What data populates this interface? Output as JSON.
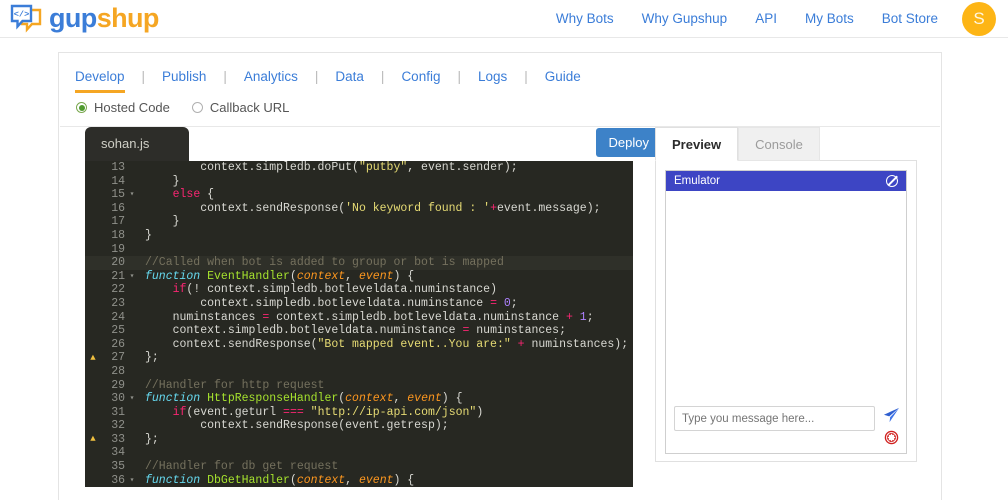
{
  "header": {
    "logo": {
      "icon": "code-chat-bubble-icon",
      "part1": "gup",
      "part2": "shup"
    },
    "nav": [
      {
        "label": "Why Bots"
      },
      {
        "label": "Why Gupshup"
      },
      {
        "label": "API"
      },
      {
        "label": "My Bots"
      },
      {
        "label": "Bot Store"
      }
    ],
    "avatar_initial": "S",
    "avatar_color": "#fdb515"
  },
  "tabs": [
    {
      "label": "Develop",
      "active": true
    },
    {
      "label": "Publish",
      "active": false
    },
    {
      "label": "Analytics",
      "active": false
    },
    {
      "label": "Data",
      "active": false
    },
    {
      "label": "Config",
      "active": false
    },
    {
      "label": "Logs",
      "active": false
    },
    {
      "label": "Guide",
      "active": false
    }
  ],
  "tab_separator": "|",
  "source_mode": {
    "options": [
      {
        "label": "Hosted Code",
        "selected": true
      },
      {
        "label": "Callback URL",
        "selected": false
      }
    ]
  },
  "editor": {
    "filename": "sohan.js",
    "deploy_label": "Deploy",
    "accent_color": "#f5a623",
    "background": "#272822",
    "lines": [
      {
        "n": 13,
        "warn": false,
        "fold": "",
        "hl": false,
        "tokens": [
          {
            "t": "        context.simpledb.doPut(",
            "c": "pl"
          },
          {
            "t": "\"putby\"",
            "c": "str"
          },
          {
            "t": ", event.sender);",
            "c": "pl"
          }
        ]
      },
      {
        "n": 14,
        "warn": false,
        "fold": "",
        "hl": false,
        "tokens": [
          {
            "t": "    }",
            "c": "pl"
          }
        ]
      },
      {
        "n": 15,
        "warn": false,
        "fold": "▾",
        "hl": false,
        "tokens": [
          {
            "t": "    ",
            "c": "pl"
          },
          {
            "t": "else",
            "c": "kw"
          },
          {
            "t": " {",
            "c": "pl"
          }
        ]
      },
      {
        "n": 16,
        "warn": false,
        "fold": "",
        "hl": false,
        "tokens": [
          {
            "t": "        context.sendResponse(",
            "c": "pl"
          },
          {
            "t": "'No keyword found : '",
            "c": "str"
          },
          {
            "t": "+",
            "c": "op"
          },
          {
            "t": "event.message);",
            "c": "pl"
          }
        ]
      },
      {
        "n": 17,
        "warn": false,
        "fold": "",
        "hl": false,
        "tokens": [
          {
            "t": "    }",
            "c": "pl"
          }
        ]
      },
      {
        "n": 18,
        "warn": false,
        "fold": "",
        "hl": false,
        "tokens": [
          {
            "t": "}",
            "c": "pl"
          }
        ]
      },
      {
        "n": 19,
        "warn": false,
        "fold": "",
        "hl": false,
        "tokens": []
      },
      {
        "n": 20,
        "warn": false,
        "fold": "",
        "hl": true,
        "tokens": [
          {
            "t": "//Called when bot is added to group or bot is mapped",
            "c": "cmt"
          }
        ]
      },
      {
        "n": 21,
        "warn": false,
        "fold": "▾",
        "hl": false,
        "tokens": [
          {
            "t": "function",
            "c": "fn"
          },
          {
            "t": " ",
            "c": "pl"
          },
          {
            "t": "EventHandler",
            "c": "fname"
          },
          {
            "t": "(",
            "c": "pl"
          },
          {
            "t": "context",
            "c": "par"
          },
          {
            "t": ", ",
            "c": "pl"
          },
          {
            "t": "event",
            "c": "par"
          },
          {
            "t": ") {",
            "c": "pl"
          }
        ]
      },
      {
        "n": 22,
        "warn": false,
        "fold": "",
        "hl": false,
        "tokens": [
          {
            "t": "    ",
            "c": "pl"
          },
          {
            "t": "if",
            "c": "kw"
          },
          {
            "t": "(! context.simpledb.botleveldata.numinstance)",
            "c": "pl"
          }
        ]
      },
      {
        "n": 23,
        "warn": false,
        "fold": "",
        "hl": false,
        "tokens": [
          {
            "t": "        context.simpledb.botleveldata.numinstance ",
            "c": "pl"
          },
          {
            "t": "=",
            "c": "op"
          },
          {
            "t": " ",
            "c": "pl"
          },
          {
            "t": "0",
            "c": "num"
          },
          {
            "t": ";",
            "c": "pl"
          }
        ]
      },
      {
        "n": 24,
        "warn": false,
        "fold": "",
        "hl": false,
        "tokens": [
          {
            "t": "    numinstances ",
            "c": "pl"
          },
          {
            "t": "=",
            "c": "op"
          },
          {
            "t": " context.simpledb.botleveldata.numinstance ",
            "c": "pl"
          },
          {
            "t": "+",
            "c": "op"
          },
          {
            "t": " ",
            "c": "pl"
          },
          {
            "t": "1",
            "c": "num"
          },
          {
            "t": ";",
            "c": "pl"
          }
        ]
      },
      {
        "n": 25,
        "warn": false,
        "fold": "",
        "hl": false,
        "tokens": [
          {
            "t": "    context.simpledb.botleveldata.numinstance ",
            "c": "pl"
          },
          {
            "t": "=",
            "c": "op"
          },
          {
            "t": " numinstances;",
            "c": "pl"
          }
        ]
      },
      {
        "n": 26,
        "warn": false,
        "fold": "",
        "hl": false,
        "tokens": [
          {
            "t": "    context.sendResponse(",
            "c": "pl"
          },
          {
            "t": "\"Bot mapped event..You are:\"",
            "c": "str"
          },
          {
            "t": " ",
            "c": "pl"
          },
          {
            "t": "+",
            "c": "op"
          },
          {
            "t": " numinstances);",
            "c": "pl"
          }
        ]
      },
      {
        "n": 27,
        "warn": true,
        "fold": "",
        "hl": false,
        "tokens": [
          {
            "t": "};",
            "c": "pl"
          }
        ]
      },
      {
        "n": 28,
        "warn": false,
        "fold": "",
        "hl": false,
        "tokens": []
      },
      {
        "n": 29,
        "warn": false,
        "fold": "",
        "hl": false,
        "tokens": [
          {
            "t": "//Handler for http request",
            "c": "cmt"
          }
        ]
      },
      {
        "n": 30,
        "warn": false,
        "fold": "▾",
        "hl": false,
        "tokens": [
          {
            "t": "function",
            "c": "fn"
          },
          {
            "t": " ",
            "c": "pl"
          },
          {
            "t": "HttpResponseHandler",
            "c": "fname"
          },
          {
            "t": "(",
            "c": "pl"
          },
          {
            "t": "context",
            "c": "par"
          },
          {
            "t": ", ",
            "c": "pl"
          },
          {
            "t": "event",
            "c": "par"
          },
          {
            "t": ") {",
            "c": "pl"
          }
        ]
      },
      {
        "n": 31,
        "warn": false,
        "fold": "",
        "hl": false,
        "tokens": [
          {
            "t": "    ",
            "c": "pl"
          },
          {
            "t": "if",
            "c": "kw"
          },
          {
            "t": "(event.geturl ",
            "c": "pl"
          },
          {
            "t": "===",
            "c": "op"
          },
          {
            "t": " ",
            "c": "pl"
          },
          {
            "t": "\"http://ip-api.com/json\"",
            "c": "str"
          },
          {
            "t": ")",
            "c": "pl"
          }
        ]
      },
      {
        "n": 32,
        "warn": false,
        "fold": "",
        "hl": false,
        "tokens": [
          {
            "t": "        context.sendResponse(event.getresp);",
            "c": "pl"
          }
        ]
      },
      {
        "n": 33,
        "warn": true,
        "fold": "",
        "hl": false,
        "tokens": [
          {
            "t": "};",
            "c": "pl"
          }
        ]
      },
      {
        "n": 34,
        "warn": false,
        "fold": "",
        "hl": false,
        "tokens": []
      },
      {
        "n": 35,
        "warn": false,
        "fold": "",
        "hl": false,
        "tokens": [
          {
            "t": "//Handler for db get request",
            "c": "cmt"
          }
        ]
      },
      {
        "n": 36,
        "warn": false,
        "fold": "▾",
        "hl": false,
        "tokens": [
          {
            "t": "function",
            "c": "fn"
          },
          {
            "t": " ",
            "c": "pl"
          },
          {
            "t": "DbGetHandler",
            "c": "fname"
          },
          {
            "t": "(",
            "c": "pl"
          },
          {
            "t": "context",
            "c": "par"
          },
          {
            "t": ", ",
            "c": "pl"
          },
          {
            "t": "event",
            "c": "par"
          },
          {
            "t": ") {",
            "c": "pl"
          }
        ]
      }
    ]
  },
  "preview": {
    "tabs": [
      {
        "label": "Preview",
        "active": true
      },
      {
        "label": "Console",
        "active": false
      }
    ],
    "emulator": {
      "title": "Emulator",
      "title_color": "#3d45c4",
      "block_icon": "block-circle-icon",
      "input_placeholder": "Type you message here...",
      "input_value": "",
      "send_icon": "send-paper-plane-icon",
      "stop_icon": "stop-badge-icon"
    }
  }
}
